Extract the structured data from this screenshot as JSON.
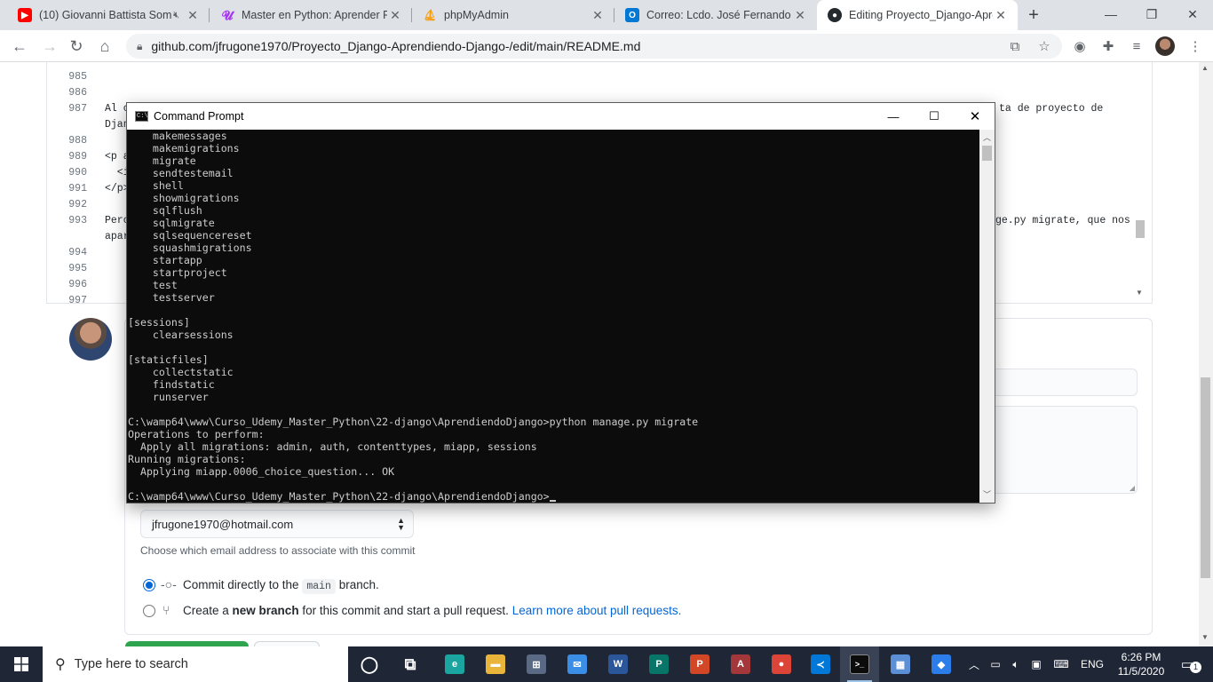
{
  "browser": {
    "tabs": [
      {
        "title": "(10) Giovanni Battista Som",
        "favicon": "youtube-icon",
        "color": "#ff0000"
      },
      {
        "title": "Master en Python: Aprender Py",
        "favicon": "udemy-icon",
        "color": "#a435f0"
      },
      {
        "title": "phpMyAdmin",
        "favicon": "phpmyadmin-icon",
        "color": "#f89c0e"
      },
      {
        "title": "Correo: Lcdo. José Fernando Fr",
        "favicon": "outlook-icon",
        "color": "#0078d4"
      },
      {
        "title": "Editing Proyecto_Django-Apre",
        "favicon": "github-icon",
        "color": "#24292e"
      }
    ],
    "url": "github.com/jfrugone1970/Proyecto_Django-Aprendiendo-Django-/edit/main/README.md"
  },
  "editor": {
    "lines": [
      {
        "n": "985",
        "text": ""
      },
      {
        "n": "986",
        "text": ""
      },
      {
        "n": "987",
        "text": "Al c"
      },
      {
        "n": "",
        "text": "Djan"
      },
      {
        "n": "988",
        "text": ""
      },
      {
        "n": "989",
        "text": "<p a"
      },
      {
        "n": "990",
        "text": "  <i"
      },
      {
        "n": "991",
        "text": "</p>"
      },
      {
        "n": "992",
        "text": ""
      },
      {
        "n": "993",
        "text": "Pero"
      },
      {
        "n": "",
        "text": "apar"
      },
      {
        "n": "994",
        "text": ""
      },
      {
        "n": "995",
        "text": ""
      },
      {
        "n": "996",
        "text": ""
      },
      {
        "n": "997",
        "text": ""
      }
    ],
    "right_fragment_1": "ta de proyecto de",
    "right_fragment_2": "ge.py migrate, que nos"
  },
  "cmd": {
    "title": "Command Prompt",
    "lines": [
      "    makemessages",
      "    makemigrations",
      "    migrate",
      "    sendtestemail",
      "    shell",
      "    showmigrations",
      "    sqlflush",
      "    sqlmigrate",
      "    sqlsequencereset",
      "    squashmigrations",
      "    startapp",
      "    startproject",
      "    test",
      "    testserver",
      "",
      "[sessions]",
      "    clearsessions",
      "",
      "[staticfiles]",
      "    collectstatic",
      "    findstatic",
      "    runserver",
      "",
      "C:\\wamp64\\www\\Curso_Udemy_Master_Python\\22-django\\AprendiendoDjango>python manage.py migrate",
      "Operations to perform:",
      "  Apply all migrations: admin, auth, contenttypes, miapp, sessions",
      "Running migrations:",
      "  Applying miapp.0006_choice_question... OK",
      ""
    ],
    "prompt": "C:\\wamp64\\www\\Curso_Udemy_Master_Python\\22-django\\AprendiendoDjango>"
  },
  "commit": {
    "email": "jfrugone1970@hotmail.com",
    "email_note": "Choose which email address to associate with this commit",
    "option1": {
      "pre": "Commit directly to the",
      "branch": "main",
      "post": "branch."
    },
    "option2": {
      "pre": "Create a",
      "bold": "new branch",
      "post": "for this commit and start a pull request.",
      "link": "Learn more about pull requests."
    }
  },
  "taskbar": {
    "search_placeholder": "Type here to search",
    "apps": [
      {
        "name": "cortana-icon",
        "color": "#1f2636",
        "label": "◯"
      },
      {
        "name": "task-view-icon",
        "color": "#1f2636",
        "label": "⧉"
      },
      {
        "name": "edge-icon",
        "color": "#1aa5a0",
        "label": "e"
      },
      {
        "name": "file-explorer-icon",
        "color": "#e8b43a",
        "label": "▬"
      },
      {
        "name": "store-icon",
        "color": "#5a6a85",
        "label": "⊞"
      },
      {
        "name": "mail-icon",
        "color": "#3a8ee6",
        "label": "✉"
      },
      {
        "name": "word-icon",
        "color": "#2b579a",
        "label": "W"
      },
      {
        "name": "publisher-icon",
        "color": "#077568",
        "label": "P"
      },
      {
        "name": "powerpoint-icon",
        "color": "#d24726",
        "label": "P"
      },
      {
        "name": "access-icon",
        "color": "#a4373a",
        "label": "A"
      },
      {
        "name": "chrome-icon",
        "color": "#db4437",
        "label": "●"
      },
      {
        "name": "vscode-icon",
        "color": "#0078d7",
        "label": "≺"
      },
      {
        "name": "command-prompt-icon",
        "color": "#0c0c0c",
        "label": ">_"
      },
      {
        "name": "paint-icon",
        "color": "#5b8fd6",
        "label": "▦"
      },
      {
        "name": "paint3d-icon",
        "color": "#2b7de9",
        "label": "◆"
      }
    ],
    "language": "ENG",
    "time": "6:26 PM",
    "date": "11/5/2020",
    "notifications": "1"
  }
}
